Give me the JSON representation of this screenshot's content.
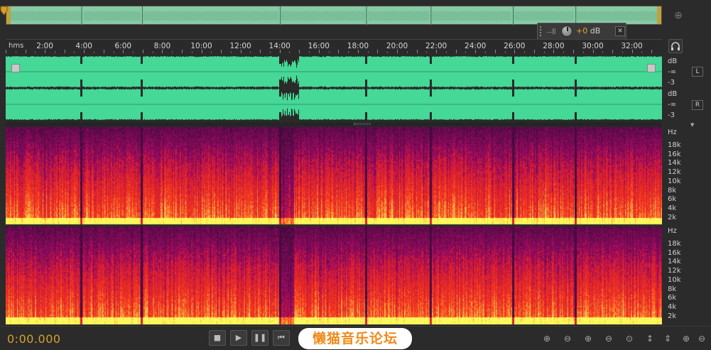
{
  "ruler": {
    "unit": "hms",
    "ticks": [
      "2:00",
      "4:00",
      "6:00",
      "8:00",
      "10:00",
      "12:00",
      "14:00",
      "16:00",
      "18:00",
      "20:00",
      "22:00",
      "24:00",
      "26:00",
      "28:00",
      "30:00",
      "32:00"
    ]
  },
  "volume": {
    "value": "+0",
    "unit": "dB",
    "meter_icon": ".....|||",
    "pin_icon": "pin-icon"
  },
  "waveform_scale": {
    "L": {
      "unit": "dB",
      "inf": "-∞",
      "minus3": "-3",
      "label": "L"
    },
    "R": {
      "unit": "dB",
      "inf": "-∞",
      "minus3": "-3",
      "label": "R"
    }
  },
  "spectral_scale": {
    "unit": "Hz",
    "labels": [
      "18k",
      "16k",
      "14k",
      "12k",
      "10k",
      "8k",
      "6k",
      "4k",
      "2k"
    ]
  },
  "transport": {
    "time": "0:00.000",
    "buttons": [
      "stop",
      "play",
      "pause",
      "go-to-start"
    ]
  },
  "watermark": "懒猫音乐论坛",
  "colors": {
    "waveform": "#45d896",
    "overview": "#88c9a6",
    "time": "#d4a02a",
    "background": "#2b2b2b"
  },
  "song_breaks_minutes": [
    3.85,
    6.95,
    14.0,
    18.4,
    21.7,
    25.9,
    29.1
  ]
}
